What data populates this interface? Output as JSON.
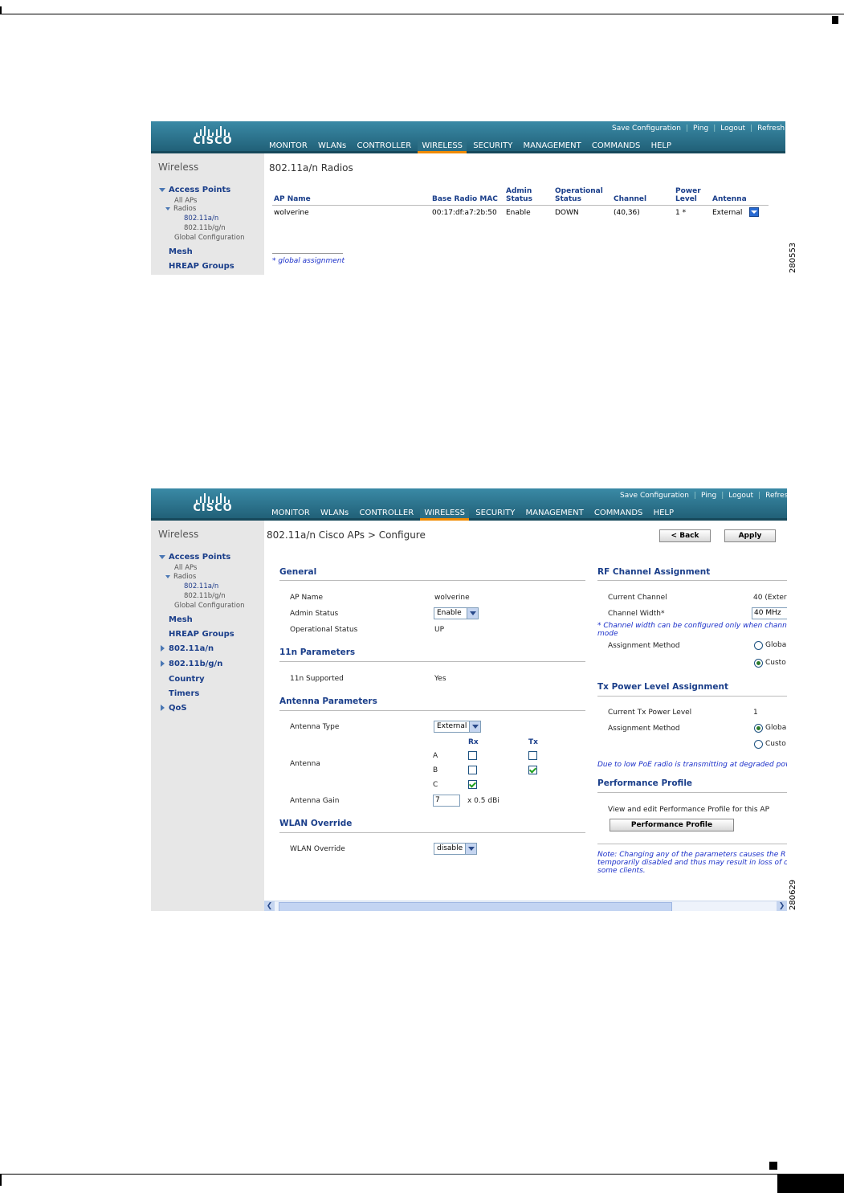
{
  "figures": {
    "fig1_id": "280553",
    "fig2_id": "280629"
  },
  "common": {
    "brand": "CISCO",
    "toplinks": [
      "Save Configuration",
      "Ping",
      "Logout",
      "Refresh"
    ],
    "toplinks2": [
      "Save Configuration",
      "Ping",
      "Logout",
      "Refres"
    ],
    "menu": [
      "MONITOR",
      "WLANs",
      "CONTROLLER",
      "WIRELESS",
      "SECURITY",
      "MANAGEMENT",
      "COMMANDS",
      "HELP"
    ],
    "active_menu": "WIRELESS",
    "sidebar_title": "Wireless",
    "sidebar": {
      "access_points": "Access Points",
      "all_aps": "All APs",
      "radios": "Radios",
      "r_a": "802.11a/n",
      "r_bg": "802.11b/g/n",
      "global_config": "Global Configuration",
      "mesh": "Mesh",
      "hreap": "HREAP Groups",
      "n_a": "802.11a/n",
      "n_bg": "802.11b/g/n",
      "country": "Country",
      "timers": "Timers",
      "qos": "QoS"
    },
    "accent_color": "#f08a00",
    "header_color": "#2b6e86"
  },
  "radios_page": {
    "title": "802.11a/n Radios",
    "columns": {
      "ap_name": "AP Name",
      "mac": "Base Radio MAC",
      "admin1": "Admin",
      "admin2": "Status",
      "op1": "Operational",
      "op2": "Status",
      "channel": "Channel",
      "pow1": "Power",
      "pow2": "Level",
      "antenna": "Antenna"
    },
    "row": {
      "ap_name": "wolverine",
      "mac": "00:17:df:a7:2b:50",
      "admin": "Enable",
      "oper": "DOWN",
      "channel": "(40,36)",
      "power": "1 *",
      "antenna": "External"
    },
    "footnote": "* global assignment"
  },
  "config_page": {
    "title": "802.11a/n Cisco APs > Configure",
    "back": "< Back",
    "apply": "Apply",
    "general": {
      "header": "General",
      "ap_name_lbl": "AP Name",
      "ap_name": "wolverine",
      "admin_lbl": "Admin Status",
      "admin": "Enable",
      "oper_lbl": "Operational Status",
      "oper": "UP"
    },
    "n11": {
      "header": "11n Parameters",
      "supported_lbl": "11n Supported",
      "supported": "Yes"
    },
    "antenna": {
      "header": "Antenna Parameters",
      "type_lbl": "Antenna Type",
      "type": "External",
      "rx": "Rx",
      "tx": "Tx",
      "antenna_lbl": "Antenna",
      "rows": [
        "A",
        "B",
        "C"
      ],
      "rx_checked": [
        false,
        false,
        true
      ],
      "tx_checked": [
        false,
        true,
        false
      ],
      "gain_lbl": "Antenna Gain",
      "gain": "7",
      "gain_unit": "x 0.5 dBi"
    },
    "wlan": {
      "header": "WLAN Override",
      "lbl": "WLAN Override",
      "value": "disable"
    },
    "rf": {
      "header": "RF Channel Assignment",
      "cur_lbl": "Current Channel",
      "cur": "40 (Exter",
      "width_lbl": "Channel Width*",
      "width": "40 MHz",
      "note1": "* Channel width can be configured only when chann",
      "note2": "mode",
      "method_lbl": "Assignment Method",
      "opt1": "Globa",
      "opt2": "Custo",
      "selected": "Custo"
    },
    "tx": {
      "header": "Tx Power Level Assignment",
      "cur_lbl": "Current Tx Power Level",
      "cur": "1",
      "method_lbl": "Assignment Method",
      "opt1": "Globa",
      "opt2": "Custo",
      "selected": "Globa",
      "poe_note": "Due to low PoE radio is transmitting at degraded pov"
    },
    "perf": {
      "header": "Performance Profile",
      "text": "View and edit Performance Profile for this AP",
      "button": "Performance Profile"
    },
    "note": [
      "Note: Changing any of the parameters causes the R",
      "temporarily disabled and thus may result in loss of c",
      "some clients."
    ]
  }
}
